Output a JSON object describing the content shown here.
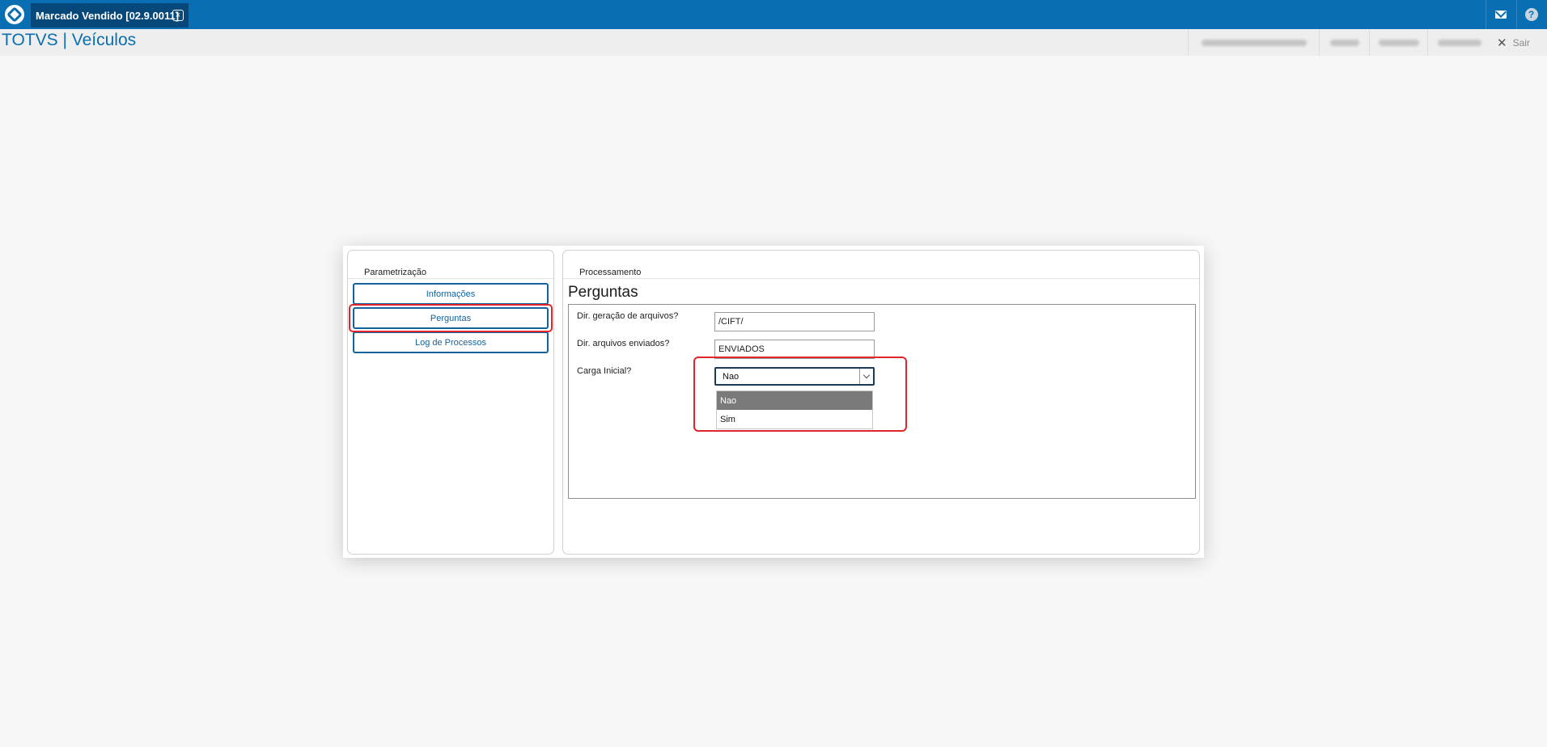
{
  "topbar": {
    "tab_title": "Marcado Vendido [02.9.0011]",
    "tab_close_icon": "close-icon",
    "mail_icon": "mail-icon",
    "help_icon": "help-icon",
    "help_glyph": "?"
  },
  "subbar": {
    "brand": "TOTVS | Veículos",
    "logout_label": "Sair",
    "logout_glyph": "✕"
  },
  "dialog": {
    "left_panel": {
      "title": "Parametrização",
      "nav": [
        "Informações",
        "Perguntas",
        "Log de Processos"
      ]
    },
    "right_panel": {
      "title": "Processamento",
      "section_title": "Perguntas",
      "questions": [
        {
          "label": "Dir. geração de arquivos?",
          "value": "/CIFT/"
        },
        {
          "label": "Dir. arquivos enviados?",
          "value": "ENVIADOS"
        },
        {
          "label": "Carga Inicial?",
          "value": "Nao"
        }
      ],
      "dropdown_options": [
        "Nao",
        "Sim"
      ]
    }
  },
  "colors": {
    "topbar": "#0a6fb2",
    "tab_active": "#06487a",
    "accent": "#14629b",
    "highlight": "#e0262c",
    "selected_option": "#7a7a7a"
  }
}
